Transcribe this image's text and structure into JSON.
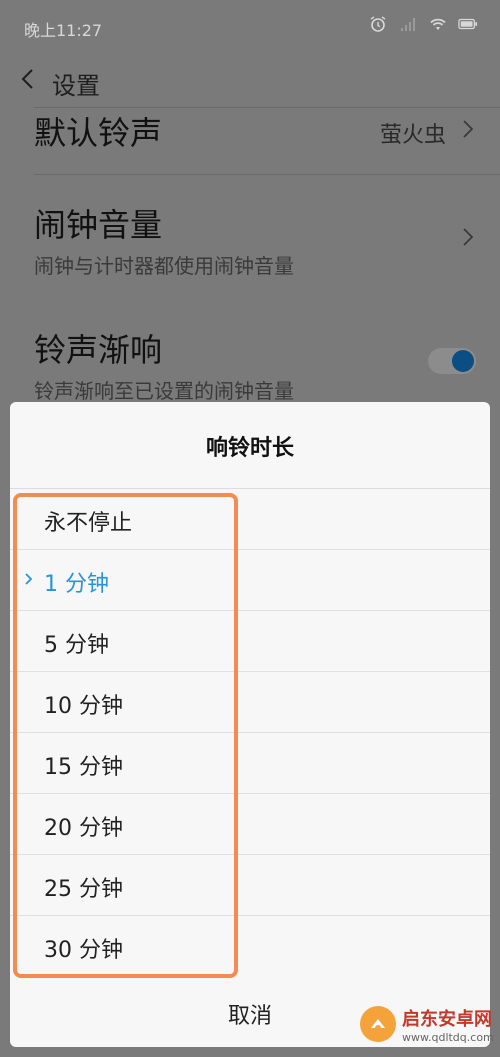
{
  "status_bar": {
    "time": "晚上11:27",
    "icons": [
      "alarm-icon",
      "signal-icon",
      "wifi-icon",
      "battery-icon"
    ]
  },
  "header": {
    "back_icon": "chevron-left-icon",
    "title": "设置"
  },
  "settings": {
    "default_ringtone": {
      "label": "默认铃声",
      "value": "萤火虫"
    },
    "alarm_volume": {
      "label": "闹钟音量",
      "subtitle": "闹钟与计时器都使用闹钟音量"
    },
    "ring_fade_in": {
      "label": "铃声渐响",
      "subtitle": "铃声渐响至已设置的闹钟音量",
      "enabled": true
    }
  },
  "dialog": {
    "title": "响铃时长",
    "options": [
      {
        "label": "永不停止",
        "selected": false
      },
      {
        "label": "1 分钟",
        "selected": true
      },
      {
        "label": "5 分钟",
        "selected": false
      },
      {
        "label": "10 分钟",
        "selected": false
      },
      {
        "label": "15 分钟",
        "selected": false
      },
      {
        "label": "20 分钟",
        "selected": false
      },
      {
        "label": "25 分钟",
        "selected": false
      },
      {
        "label": "30 分钟",
        "selected": false
      }
    ],
    "cancel_label": "取消",
    "selected_check_icon": "check-chevron-icon"
  },
  "colors": {
    "accent": "#2893d7",
    "highlight_border": "#f28c52",
    "dim_overlay": "#7a7a7a"
  },
  "watermark": {
    "main": "启东安卓网",
    "sub": "www.qdltdq.com"
  }
}
